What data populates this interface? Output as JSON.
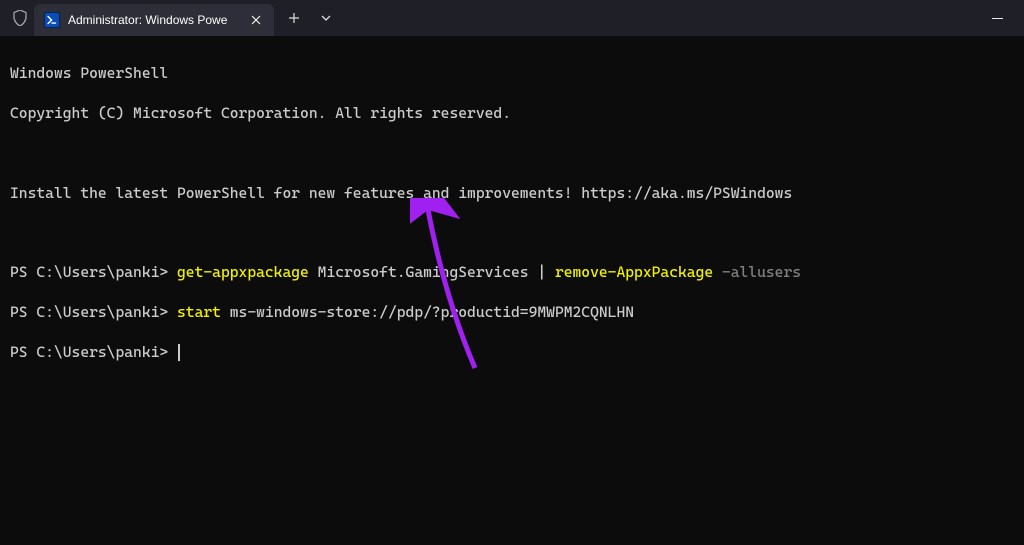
{
  "titlebar": {
    "tab_title": "Administrator: Windows Powe"
  },
  "terminal": {
    "line1": "Windows PowerShell",
    "line2": "Copyright (C) Microsoft Corporation. All rights reserved.",
    "line3": "Install the latest PowerShell for new features and improvements! https://aka.ms/PSWindows",
    "prompt": "PS C:\\Users\\panki> ",
    "cmd1": {
      "cmdlet1": "get-appxpackage",
      "arg1": " Microsoft.GamingServices | ",
      "cmdlet2": "remove-AppxPackage",
      "param": " -allusers"
    },
    "cmd2": {
      "cmdlet": "start",
      "arg": " ms-windows-store://pdp/?productid=9MWPM2CQNLHN"
    }
  }
}
